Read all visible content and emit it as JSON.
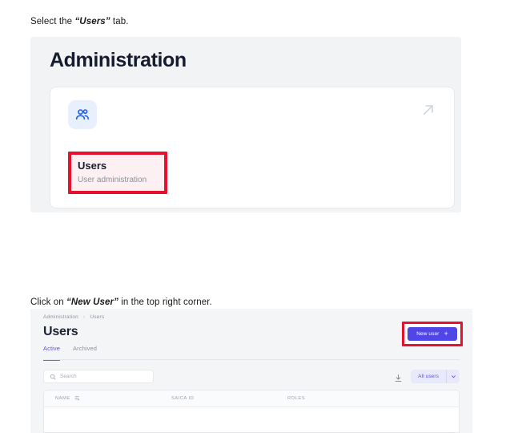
{
  "instructions": {
    "step1_prefix": "Select the ",
    "step1_emph": "“Users”",
    "step1_suffix": " tab.",
    "step2_prefix": "Click on ",
    "step2_emph": "“New User”",
    "step2_suffix": " in the top right corner."
  },
  "admin_screen": {
    "title": "Administration",
    "card": {
      "icon": "users-group-icon",
      "open_icon": "arrow-up-right-icon",
      "title": "Users",
      "subtitle": "User administration"
    }
  },
  "users_screen": {
    "breadcrumb": {
      "root": "Administration",
      "separator": "›",
      "current": "Users"
    },
    "page_title": "Users",
    "new_user_button": {
      "label": "New user",
      "plus": "+"
    },
    "tabs": [
      {
        "label": "Active",
        "active": true
      },
      {
        "label": "Archived",
        "active": false
      }
    ],
    "search": {
      "placeholder": "Search",
      "value": "",
      "icon": "search-icon"
    },
    "toolbar": {
      "download_icon": "download-icon",
      "filter_label": "All users",
      "caret_icon": "chevron-down-icon"
    },
    "table": {
      "columns": [
        "NAME",
        "SAICA ID",
        "ROLES"
      ],
      "name_sort_icon": "sort-filter-icon",
      "rows": []
    }
  },
  "colors": {
    "accent_purple": "#4f46e5",
    "tab_active": "#5b53e0",
    "highlight_red": "#e8112d",
    "icon_blue": "#2563eb",
    "icon_bg_blue": "#e9f0fd",
    "panel_bg": "#f1f3f5",
    "page_bg": "#ffffff"
  }
}
